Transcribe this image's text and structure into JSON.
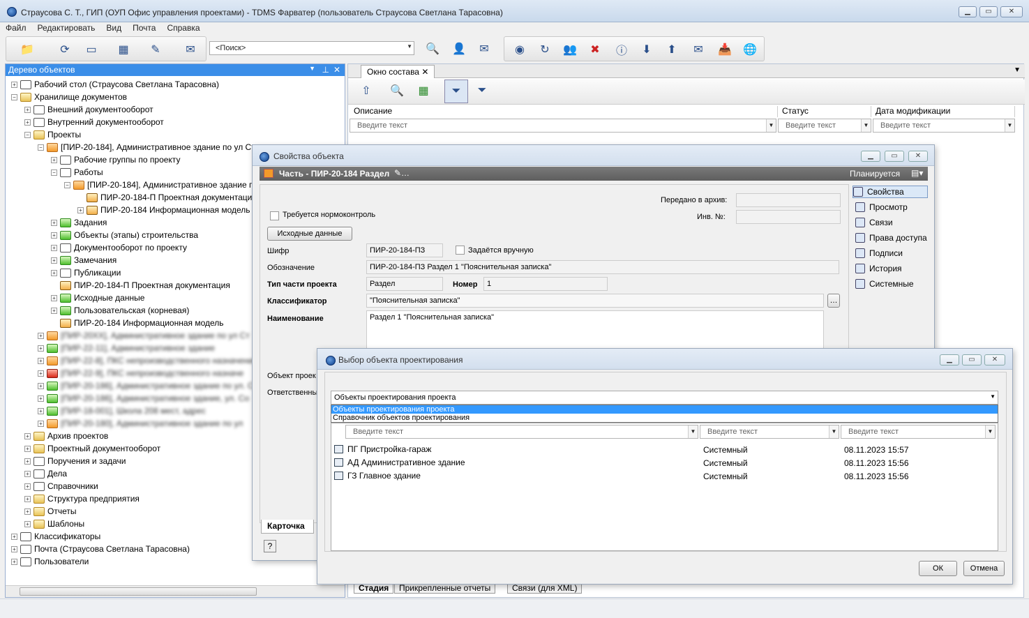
{
  "window": {
    "title": "Страусова С. Т., ГИП (ОУП Офис управления проектами) - TDMS Фарватер (пользователь Страусова Светлана Тарасовна)",
    "min": "▁",
    "max": "▭",
    "close": "✕"
  },
  "menu": [
    "Файл",
    "Редактировать",
    "Вид",
    "Почта",
    "Справка"
  ],
  "search": {
    "value": "<Поиск>"
  },
  "tree_panel": {
    "title": "Дерево объектов",
    "pin": "⊥",
    "close": "✕",
    "menu": "▼"
  },
  "tree": [
    {
      "label": "Рабочий стол (Страусова Светлана Тарасовна)",
      "exp": "+"
    },
    {
      "label": "Хранилище документов",
      "exp": "−"
    },
    {
      "label": "Внешний документооборот",
      "exp": "+"
    },
    {
      "label": "Внутренний документооборот",
      "exp": "+"
    },
    {
      "label": "Проекты",
      "exp": "−"
    },
    {
      "label": "[ПИР-20-184], Административное здание по ул Ст",
      "exp": "−"
    },
    {
      "label": "Рабочие группы по проекту",
      "exp": "+"
    },
    {
      "label": "Работы",
      "exp": "−"
    },
    {
      "label": "[ПИР-20-184], Административное здание п",
      "exp": "−"
    },
    {
      "label": "ПИР-20-184-П Проектная документация",
      "exp": ""
    },
    {
      "label": "ПИР-20-184 Информационная модель",
      "exp": "+"
    },
    {
      "label": "Задания",
      "exp": "+"
    },
    {
      "label": "Объекты (этапы) строительства",
      "exp": "+"
    },
    {
      "label": "Документооборот по проекту",
      "exp": "+"
    },
    {
      "label": "Замечания",
      "exp": "+"
    },
    {
      "label": "Публикации",
      "exp": "+"
    },
    {
      "label": "ПИР-20-184-П Проектная документация",
      "exp": ""
    },
    {
      "label": "Исходные данные",
      "exp": "+"
    },
    {
      "label": "Пользовательская (корневая)",
      "exp": "+"
    },
    {
      "label": "ПИР-20-184 Информационная модель",
      "exp": ""
    },
    {
      "label": "[ПИР-20XX], Административное здание по ул Ст",
      "exp": "+"
    },
    {
      "label": "[ПИР-22-11], Административное здание",
      "exp": "+"
    },
    {
      "label": "[ПИР-22-8], ПКС непроизводственного назначения",
      "exp": "+"
    },
    {
      "label": "[ПИР-22-9], ПКС непроизводственного назначе",
      "exp": "+"
    },
    {
      "label": "[ПИР-20-186], Административное здание по ул. Ст",
      "exp": "+"
    },
    {
      "label": "[ПИР-20-186], Административное здание, ул. Со",
      "exp": "+"
    },
    {
      "label": "[ПИР-18-001], Школа 208 мест, адрес",
      "exp": "+"
    },
    {
      "label": "[ПИР-20-180], Административное здание по ул",
      "exp": "+"
    },
    {
      "label": "Архив проектов",
      "exp": "+"
    },
    {
      "label": "Проектный документооборот",
      "exp": "+"
    },
    {
      "label": "Поручения и задачи",
      "exp": "+"
    },
    {
      "label": "Дела",
      "exp": "+"
    },
    {
      "label": "Справочники",
      "exp": "+"
    },
    {
      "label": "Структура предприятия",
      "exp": "+"
    },
    {
      "label": "Отчеты",
      "exp": "+"
    },
    {
      "label": "Шаблоны",
      "exp": "+"
    },
    {
      "label": "Классификаторы",
      "exp": "+"
    },
    {
      "label": "Почта (Страусова Светлана Тарасовна)",
      "exp": "+"
    },
    {
      "label": "Пользователи",
      "exp": "+"
    }
  ],
  "composition": {
    "tab": "Окно состава",
    "tab_close": "✕",
    "columns": [
      "Описание",
      "Статус",
      "Дата модификации"
    ],
    "filter_placeholder": "Введите текст",
    "bottom_tabs": [
      "Стадия",
      "Прикрепленные отчеты",
      "Связи (для XML)"
    ]
  },
  "props": {
    "title": "Свойства объекта",
    "header": "Часть - ПИР-20-184 Раздел",
    "status": "Планируется",
    "archived_label": "Передано в архив:",
    "inv_label": "Инв. №:",
    "normcontrol": "Требуется нормоконтроль",
    "source_btn": "Исходные данные",
    "cipher_label": "Шифр",
    "cipher": "ПИР-20-184-ПЗ",
    "manual": "Задаётся вручную",
    "designation_label": "Обозначение",
    "designation": "ПИР-20-184-ПЗ Раздел 1 \"Пояснительная записка\"",
    "type_label": "Тип части проекта",
    "type": "Раздел",
    "number_label": "Номер",
    "number": "1",
    "classifier_label": "Классификатор",
    "classifier": "\"Пояснительная записка\"",
    "name_label": "Наименование",
    "name": "Раздел 1 \"Пояснительная записка\"",
    "object_label": "Объект проек",
    "resp_label": "Ответственны",
    "card_tab": "Карточка",
    "help": "?",
    "side": [
      "Свойства",
      "Просмотр",
      "Связи",
      "Права доступа",
      "Подписи",
      "История",
      "Системные"
    ]
  },
  "select": {
    "title": "Выбор объекта проектирования",
    "combo": "Объекты проектирования проекта",
    "options": [
      "Объекты проектирования проекта",
      "Справочник объектов проектирования"
    ],
    "filter_placeholder": "Введите текст",
    "rows": [
      {
        "name": "ПГ Пристройка-гараж",
        "type": "Системный",
        "date": "08.11.2023 15:57"
      },
      {
        "name": "АД Административное здание",
        "type": "Системный",
        "date": "08.11.2023 15:56"
      },
      {
        "name": "ГЗ Главное здание",
        "type": "Системный",
        "date": "08.11.2023 15:56"
      }
    ],
    "ok": "ОК",
    "cancel": "Отмена"
  }
}
